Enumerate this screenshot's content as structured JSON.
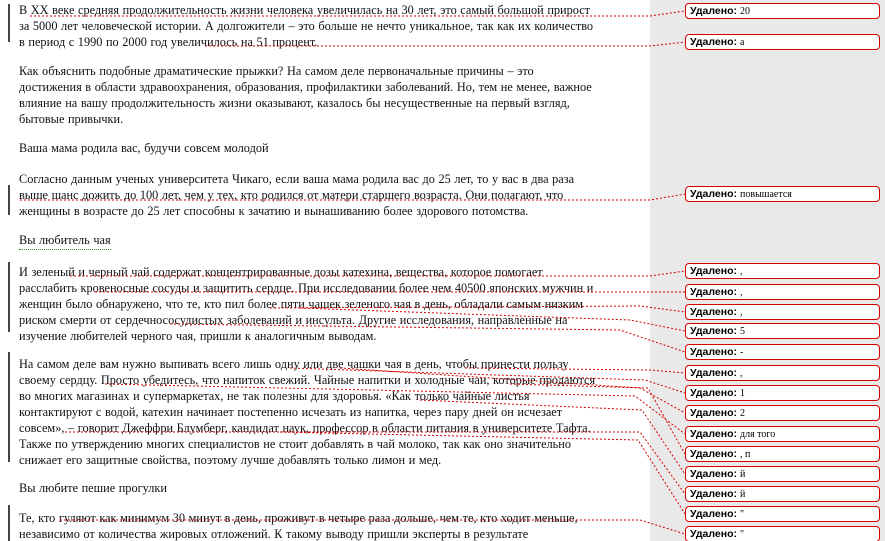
{
  "document": {
    "lines": [
      "В XX веке средняя продолжительность жизни человека увеличилась на 30 лет, это самый большой прирост",
      "за 5000 лет человеческой истории. А долгожители – это больше не нечто уникальное, так как их количество",
      "в период с 1990 по 2000 год увеличилось на 51 процент.",
      "Как объяснить подобные драматические прыжки? На самом деле первоначальные причины – это",
      "достижения в области здравоохранения, образования, профилактики заболеваний. Но, тем не менее, важное",
      "влияние на вашу продолжительность жизни оказывают, казалось бы несущественные на первый взгляд,",
      "бытовые привычки.",
      "Ваша мама родила вас, будучи совсем молодой",
      "Согласно данным ученых университета Чикаго, если ваша мама родила вас до 25 лет, то у вас в два раза",
      "выше шанс дожить до 100 лет, чем у тех, кто родился от матери старшего возраста. Они полагают, что",
      "женщины в возрасте до 25 лет способны к зачатию и вынашиванию более здорового потомства.",
      "Вы любитель чая",
      "И зеленый и черный чай содержат концентрированные дозы катехина, вещества, которое помогает",
      "расслабить кровеносные сосуды и защитить сердце. При исследовании более чем 40500 японских мужчин и",
      "женщин было обнаружено, что те, кто пил более пяти чашек зеленого чая в день, обладали самым низким",
      "риском смерти от сердечнососудистых заболеваний и инсульта. Другие исследования, направленные на",
      "изучение любителей черного чая, пришли к аналогичным выводам.",
      "На самом деле вам нужно выпивать всего лишь одну или две чашки чая в день, чтобы принести пользу",
      "своему сердцу. Просто убедитесь, что напиток свежий. Чайные напитки и холодные чаи, которые продаются",
      "во многих магазинах и супермаркетах, не так полезны для здоровья. «Как только чайные листья",
      "контактируют с водой, катехин начинает постепенно исчезать из напитка, через пару дней он исчезает",
      "совсем», – говорит Джеффри Блумберг, кандидат наук, профессор в области питания в университете Тафта.",
      "Также по утверждению многих специалистов не стоит добавлять в чай молоко, так как оно значительно",
      "снижает его защитные свойства, поэтому лучше добавлять только лимон и мед.",
      "Вы любите пешие прогулки",
      "Те, кто гуляют как минимум 30 минут в день, проживут в четыре раза дольше, чем те, кто ходит меньше,",
      "независимо от количества жировых отложений. К такому выводу пришли эксперты в результате"
    ]
  },
  "comments": {
    "label": "Удалено:",
    "items": [
      "20",
      "а",
      "повышается",
      ",",
      ",",
      ",",
      "5",
      "-",
      ",",
      "1",
      "2",
      "для того",
      ", п",
      "й",
      "й",
      "\"",
      "\""
    ]
  },
  "colors": {
    "revision": "#d90000",
    "balloon_border": "#d40000",
    "margin_bg": "#e9e9e9",
    "grammar_squiggle": "#2a9a2a"
  }
}
